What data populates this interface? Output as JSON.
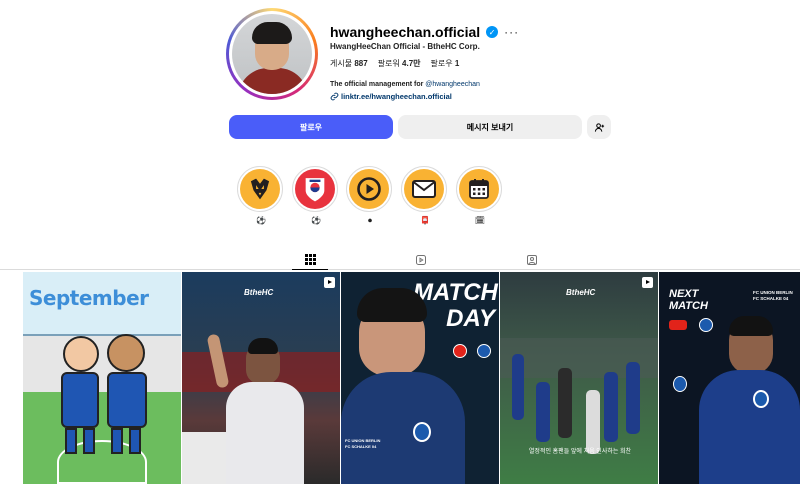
{
  "profile": {
    "username": "hwangheechan.official",
    "more_glyph": "···",
    "full_name": "HwangHeeChan Official - BtheHC Corp.",
    "stats": [
      {
        "label": "게시물",
        "value": "887"
      },
      {
        "label": "팔로워",
        "value": "4.7만"
      },
      {
        "label": "팔로우",
        "value": "1"
      }
    ],
    "bio_text": "The official management for ",
    "bio_mention": "@hwangheechan",
    "link": "linktr.ee/hwangheechan.official"
  },
  "actions": {
    "follow": "팔로우",
    "message": "메시지 보내기",
    "suggest_icon": "add-person-icon"
  },
  "highlights": [
    {
      "icon": "wolves-crest-icon",
      "label": "⚽"
    },
    {
      "icon": "korea-crest-icon",
      "label": "⚽"
    },
    {
      "icon": "play-icon",
      "label": "⏺"
    },
    {
      "icon": "mail-icon",
      "label": "📮"
    },
    {
      "icon": "calendar-icon",
      "label": "🗓"
    }
  ],
  "tabs": [
    {
      "name": "posts-tab",
      "icon": "grid-icon",
      "active": true
    },
    {
      "name": "reels-tab",
      "icon": "reels-icon",
      "active": false
    },
    {
      "name": "tagged-tab",
      "icon": "tagged-icon",
      "active": false
    }
  ],
  "posts": [
    {
      "title": "September",
      "kind": "illustration"
    },
    {
      "brand": "BtheHC",
      "kind": "reel"
    },
    {
      "title_line1": "MATCH",
      "title_line2": "DAY",
      "caption_lines": [
        "FC UNION BERLIN",
        "FC SCHALKE 04"
      ],
      "kind": "reel"
    },
    {
      "brand": "BtheHC",
      "caption": "열정적인 홈팬들 앞에 처음 인사하는 희찬",
      "kind": "reel"
    },
    {
      "title_line1": "NEXT",
      "title_line2": "MATCH",
      "club_line1": "FC UNION BERLIN",
      "club_line2": "FC SCHALKE 04",
      "kind": "reel"
    }
  ]
}
